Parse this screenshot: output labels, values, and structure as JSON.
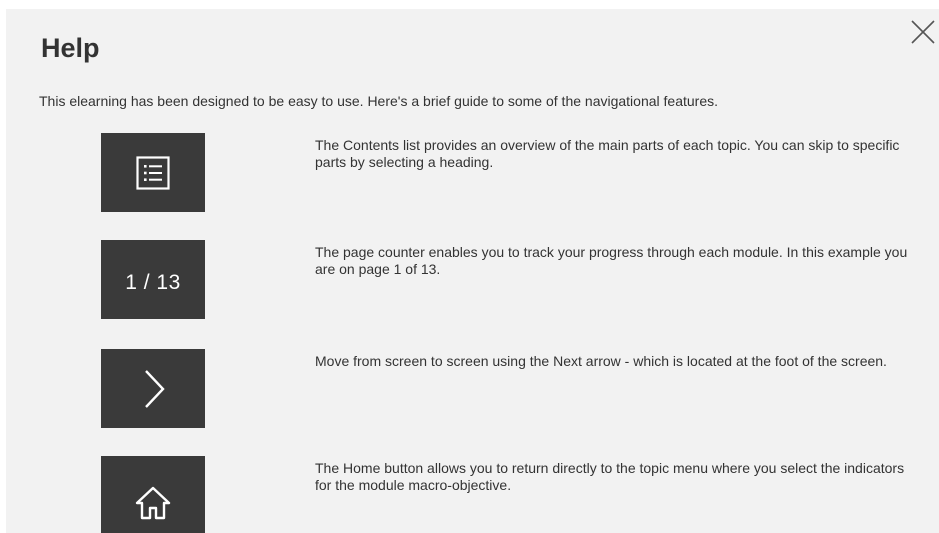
{
  "dialog": {
    "title": "Help",
    "intro": "This elearning has been designed to be easy to use. Here's a brief guide to some of the navigational features.",
    "close_icon": "close-icon"
  },
  "features": [
    {
      "icon": "contents-list-icon",
      "description": "The Contents list provides an overview of the main parts of each topic. You can skip to specific parts by selecting a heading."
    },
    {
      "icon": "page-counter",
      "counter_text": "1 / 13",
      "description": "The page counter enables you to track your progress through each module. In this example you are on page 1 of 13."
    },
    {
      "icon": "chevron-right-icon",
      "description": "Move from screen to screen using the Next arrow - which is located at the foot of the screen."
    },
    {
      "icon": "home-icon",
      "description": "The Home button allows you to return directly to the topic menu where you select the indicators for the module macro-objective."
    }
  ],
  "colors": {
    "panel_background": "#f2f2f2",
    "tile_background": "#3a3a3a",
    "text": "#333333"
  }
}
